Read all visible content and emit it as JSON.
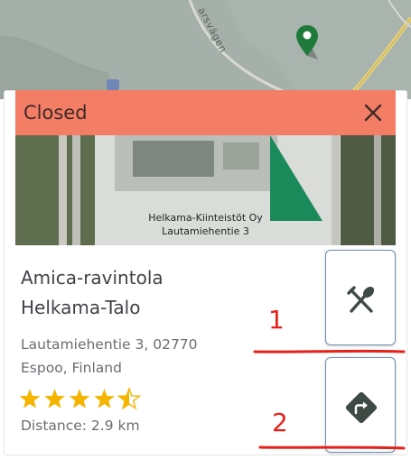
{
  "map": {
    "road_label": "arsvägen",
    "pin_color": "#1f7a3a"
  },
  "status": {
    "label": "Closed",
    "color": "#f47d66",
    "close_icon": "close-icon"
  },
  "photo": {
    "sign_line_1": "Helkama-Kiinteistöt Oy",
    "sign_line_2": "Lautamiehentie 3"
  },
  "place": {
    "name_line_1": "Amica-ravintola",
    "name_line_2": "Helkama-Talo",
    "address_line_1": "Lautamiehentie 3, 02770",
    "address_line_2": "Espoo, Finland",
    "rating": 4.5,
    "rating_max": 5,
    "star_color": "#f4b400",
    "distance": "Distance: 2.9 km"
  },
  "actions": {
    "restaurant_icon": "fork-spoon-icon",
    "directions_icon": "directions-icon"
  },
  "annotations": {
    "label_1": "1",
    "label_2": "2",
    "color": "#e8201a"
  }
}
